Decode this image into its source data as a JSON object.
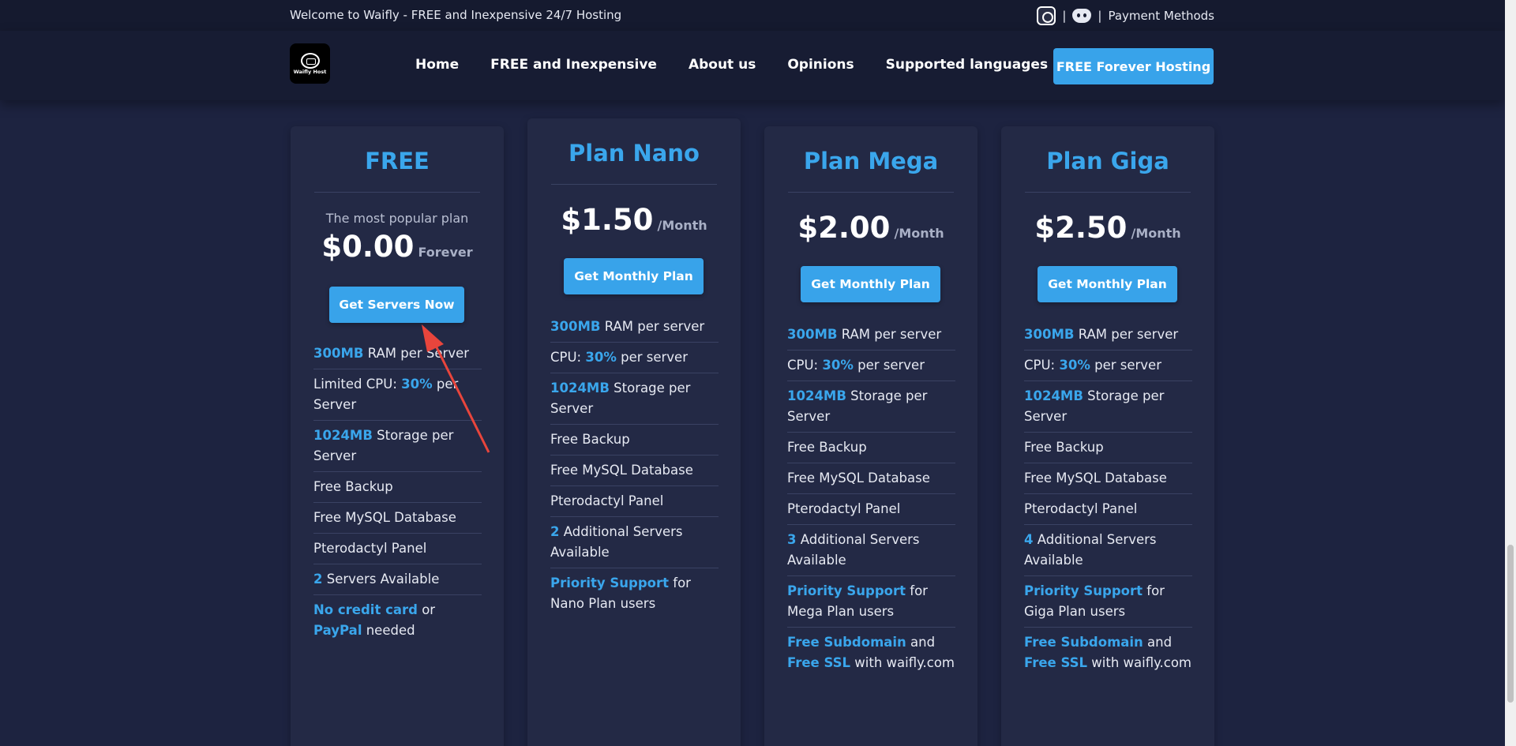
{
  "topbar": {
    "welcome": "Welcome to Waifly - FREE and Inexpensive 24/7 Hosting",
    "separator": "|",
    "payment_methods": "Payment Methods",
    "icons": [
      "instagram-icon",
      "discord-icon"
    ]
  },
  "navbar": {
    "logo_text": "Waifly Host",
    "links": [
      "Home",
      "FREE and Inexpensive",
      "About us",
      "Opinions",
      "Supported languages"
    ],
    "cta": "FREE Forever Hosting"
  },
  "colors": {
    "accent": "#38a3ea",
    "background": "#1d2340",
    "card": "#232945",
    "annotation_arrow": "#e8453c"
  },
  "plans": [
    {
      "title": "FREE",
      "subtitle": "The most popular plan",
      "price": "$0.00",
      "period": "Forever",
      "button": "Get Servers Now",
      "features": [
        [
          {
            "t": "300MB",
            "h": true
          },
          {
            "t": " RAM per Server"
          }
        ],
        [
          {
            "t": "Limited CPU: "
          },
          {
            "t": "30%",
            "h": true
          },
          {
            "t": " per Server"
          }
        ],
        [
          {
            "t": "1024MB",
            "h": true
          },
          {
            "t": " Storage per Server"
          }
        ],
        [
          {
            "t": "Free Backup"
          }
        ],
        [
          {
            "t": "Free MySQL Database"
          }
        ],
        [
          {
            "t": "Pterodactyl Panel"
          }
        ],
        [
          {
            "t": "2",
            "h": true
          },
          {
            "t": " Servers Available"
          }
        ],
        [
          {
            "t": "No credit card",
            "h": true
          },
          {
            "t": " or "
          },
          {
            "t": "PayPal",
            "h": true
          },
          {
            "t": " needed"
          }
        ]
      ]
    },
    {
      "title": "Plan Nano",
      "subtitle": "",
      "price": "$1.50",
      "period": "/Month",
      "button": "Get Monthly Plan",
      "features": [
        [
          {
            "t": "300MB",
            "h": true
          },
          {
            "t": " RAM per server"
          }
        ],
        [
          {
            "t": "CPU: "
          },
          {
            "t": "30%",
            "h": true
          },
          {
            "t": " per server"
          }
        ],
        [
          {
            "t": "1024MB",
            "h": true
          },
          {
            "t": " Storage per Server"
          }
        ],
        [
          {
            "t": "Free Backup"
          }
        ],
        [
          {
            "t": "Free MySQL Database"
          }
        ],
        [
          {
            "t": "Pterodactyl Panel"
          }
        ],
        [
          {
            "t": "2",
            "h": true
          },
          {
            "t": " Additional Servers Available"
          }
        ],
        [
          {
            "t": "Priority Support",
            "h": true
          },
          {
            "t": " for Nano Plan users"
          }
        ]
      ]
    },
    {
      "title": "Plan Mega",
      "subtitle": "",
      "price": "$2.00",
      "period": "/Month",
      "button": "Get Monthly Plan",
      "features": [
        [
          {
            "t": "300MB",
            "h": true
          },
          {
            "t": " RAM per server"
          }
        ],
        [
          {
            "t": "CPU: "
          },
          {
            "t": "30%",
            "h": true
          },
          {
            "t": " per server"
          }
        ],
        [
          {
            "t": "1024MB",
            "h": true
          },
          {
            "t": " Storage per Server"
          }
        ],
        [
          {
            "t": "Free Backup"
          }
        ],
        [
          {
            "t": "Free MySQL Database"
          }
        ],
        [
          {
            "t": "Pterodactyl Panel"
          }
        ],
        [
          {
            "t": "3",
            "h": true
          },
          {
            "t": " Additional Servers Available"
          }
        ],
        [
          {
            "t": "Priority Support",
            "h": true
          },
          {
            "t": " for Mega Plan users"
          }
        ],
        [
          {
            "t": "Free Subdomain",
            "h": true
          },
          {
            "t": " and "
          },
          {
            "t": "Free SSL",
            "h": true
          },
          {
            "t": " with waifly.com"
          }
        ]
      ]
    },
    {
      "title": "Plan Giga",
      "subtitle": "",
      "price": "$2.50",
      "period": "/Month",
      "button": "Get Monthly Plan",
      "features": [
        [
          {
            "t": "300MB",
            "h": true
          },
          {
            "t": " RAM per server"
          }
        ],
        [
          {
            "t": "CPU: "
          },
          {
            "t": "30%",
            "h": true
          },
          {
            "t": " per server"
          }
        ],
        [
          {
            "t": "1024MB",
            "h": true
          },
          {
            "t": " Storage per Server"
          }
        ],
        [
          {
            "t": "Free Backup"
          }
        ],
        [
          {
            "t": "Free MySQL Database"
          }
        ],
        [
          {
            "t": "Pterodactyl Panel"
          }
        ],
        [
          {
            "t": "4",
            "h": true
          },
          {
            "t": " Additional Servers Available"
          }
        ],
        [
          {
            "t": "Priority Support",
            "h": true
          },
          {
            "t": " for Giga Plan users"
          }
        ],
        [
          {
            "t": "Free Subdomain",
            "h": true
          },
          {
            "t": " and "
          },
          {
            "t": "Free SSL",
            "h": true
          },
          {
            "t": " with waifly.com"
          }
        ]
      ]
    }
  ]
}
